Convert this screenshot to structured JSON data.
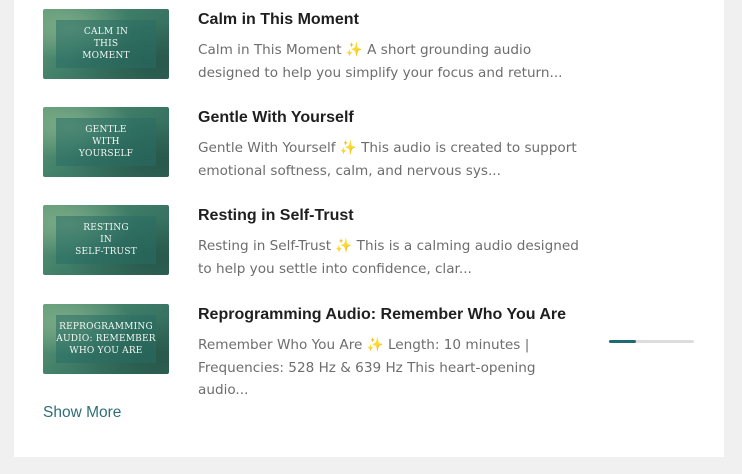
{
  "items": [
    {
      "thumb_text": "Calm in\nthis\nmoment",
      "title": "Calm in This Moment",
      "desc_title": "Calm in This Moment",
      "desc_body": " A short grounding audio designed to help you simplify your focus and return..."
    },
    {
      "thumb_text": "Gentle\nwith\nyourself",
      "title": "Gentle With Yourself",
      "desc_title": "Gentle With Yourself",
      "desc_body": " This audio is created to support emotional softness, calm, and nervous sys..."
    },
    {
      "thumb_text": "Resting\nin\nself-trust",
      "title": "Resting in Self-Trust",
      "desc_title": "Resting in Self-Trust",
      "desc_body": " This is a calming audio designed to help you settle into confidence, clar..."
    },
    {
      "thumb_text": "Reprogramming\naudio: remember\nwho you are",
      "title": "Reprogramming Audio: Remember Who You Are",
      "desc_title": "Remember Who You Are",
      "desc_body": " Length: 10 minutes    | Frequencies: 528 Hz & 639 Hz This heart-opening audio...",
      "progress": 0.32
    }
  ],
  "sparkle": "✨",
  "show_more": "Show More",
  "colors": {
    "accent": "#1e6b73",
    "link": "#2f6e78",
    "sparkle": "#f2d165"
  }
}
